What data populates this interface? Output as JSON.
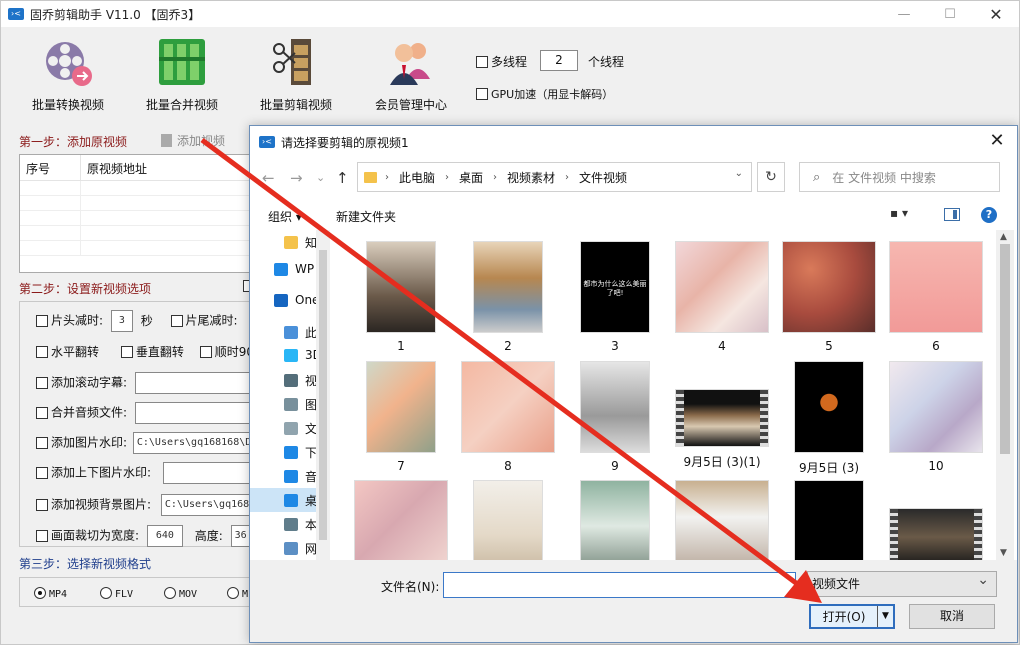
{
  "app": {
    "title": "固乔剪辑助手 V11.0  【固乔3】",
    "logo_text": "›<",
    "window_controls": {
      "minimize": "—",
      "maximize": "☐",
      "close": "✕"
    },
    "toolbar": [
      {
        "label": "批量转换视频",
        "icon": "film-reel-convert-icon"
      },
      {
        "label": "批量合并视频",
        "icon": "green-blocks-merge-icon"
      },
      {
        "label": "批量剪辑视频",
        "icon": "film-scissors-icon"
      },
      {
        "label": "会员管理中心",
        "icon": "members-icon"
      }
    ],
    "multithread": {
      "label": "多线程",
      "threads": "2",
      "threads_suffix": "个线程"
    },
    "gpu": {
      "label": "GPU加速（用显卡解码）"
    },
    "step1": {
      "title": "第一步：添加原视频",
      "add_button": "添加视频"
    },
    "file_list": {
      "col_index": "序号",
      "col_path": "原视频地址"
    },
    "step2": {
      "title": "第二步：设置新视频选项"
    },
    "options": {
      "head_cut": "片头减时:",
      "head_value": "3",
      "seconds": "秒",
      "tail_cut": "片尾减时:",
      "hflip": "水平翻转",
      "vflip": "垂直翻转",
      "rotate90": "顺时90",
      "scroll_subtitle": "添加滚动字幕:",
      "merge_audio": "合并音频文件:",
      "image_watermark": "添加图片水印:",
      "image_watermark_path": "C:\\Users\\gq168168\\D",
      "top_bottom_watermark": "添加上下图片水印:",
      "bg_image": "添加视频背景图片:",
      "bg_image_path": "C:\\Users\\gq168",
      "crop": "画面裁切为宽度:",
      "crop_width": "640",
      "crop_height_label": "高度:",
      "crop_height": "36"
    },
    "step3": {
      "title": "第三步：选择新视频格式"
    },
    "formats": [
      "MP4",
      "FLV",
      "MOV",
      "M"
    ]
  },
  "dialog": {
    "title": "请选择要剪辑的原视频1",
    "close": "✕",
    "nav": {
      "back": "←",
      "forward": "→",
      "recent": "⌄",
      "up": "↑"
    },
    "breadcrumb": [
      "此电脑",
      "桌面",
      "视频素材",
      "文件视频"
    ],
    "refresh": "↻",
    "search_placeholder": "在 文件视频 中搜索",
    "organize": "组织 ▾",
    "new_folder": "新建文件夹",
    "view_label": "▪ ▾",
    "help": "?",
    "tree": [
      {
        "label": "知",
        "icon": "folder-icon",
        "color": "#f4c24b"
      },
      {
        "label": "WP",
        "icon": "cloud-icon",
        "color": "#1e88e5"
      },
      {
        "label": "One",
        "icon": "onedrive-icon",
        "color": "#1565c0"
      },
      {
        "label": "此电",
        "icon": "computer-icon",
        "color": "#4a90d9"
      },
      {
        "label": "3D",
        "icon": "3d-objects-icon",
        "color": "#29b6f6"
      },
      {
        "label": "视",
        "icon": "videos-icon",
        "color": "#546e7a"
      },
      {
        "label": "图",
        "icon": "pictures-icon",
        "color": "#78909c"
      },
      {
        "label": "文",
        "icon": "documents-icon",
        "color": "#90a4ae"
      },
      {
        "label": "下",
        "icon": "downloads-icon",
        "color": "#1e88e5"
      },
      {
        "label": "音",
        "icon": "music-icon",
        "color": "#1e88e5"
      },
      {
        "label": "桌",
        "icon": "desktop-icon",
        "color": "#1e88e5",
        "selected": true
      },
      {
        "label": "本",
        "icon": "local-disk-icon",
        "color": "#607d8b"
      },
      {
        "label": "网",
        "icon": "network-icon",
        "color": "#5c8fc4"
      }
    ],
    "files": [
      {
        "name": "1",
        "bg": "linear-gradient(#d9cdbd,#6b5a4a 60%,#2b2622)",
        "portrait": true
      },
      {
        "name": "2",
        "bg": "linear-gradient(#e8d4b8,#b78750 40%,#7a92a8 75%,#ccc)",
        "portrait": true
      },
      {
        "name": "3",
        "bg": "#000",
        "portrait": true,
        "caption": "都市为什么这么美丽了吧!"
      },
      {
        "name": "4",
        "bg": "linear-gradient(135deg,#f2d7d9,#e8b4a8 40%,#f5e6e0 70%,#d8c0c8)",
        "portrait": false
      },
      {
        "name": "5",
        "bg": "radial-gradient(circle at 30% 30%,#d97a5a,#a84b3e 50%,#5a2e2a)",
        "portrait": false
      },
      {
        "name": "6",
        "bg": "linear-gradient(#f6b7b0,#f29a98)",
        "portrait": false
      },
      {
        "name": "7",
        "bg": "linear-gradient(135deg,#cfd8c8,#f1b38c 45%,#8fa089)",
        "portrait": true
      },
      {
        "name": "8",
        "bg": "linear-gradient(135deg,#f4b8a2,#f5d0c2 50%,#e9a08a)",
        "portrait": false
      },
      {
        "name": "9",
        "bg": "linear-gradient(#e6e6e6,#9a9a9a 60%,#dcdcdc)",
        "portrait": true
      },
      {
        "name": "9月5日 (3)(1)",
        "bg": "linear-gradient(#111,#111 25%,#8a6a4a 45%,#d8c8b0 65%,#111)",
        "portrait": false,
        "film": true
      },
      {
        "name": "9月5日 (3)",
        "bg": "radial-gradient(circle at 50% 45%,#d2691e 0 14%,#000 15%)",
        "portrait": true
      },
      {
        "name": "10",
        "bg": "linear-gradient(135deg,#f1e9ee,#cdd3e8 40%,#b8a8c8 70%,#e8e4ec)",
        "portrait": false
      },
      {
        "name": "",
        "bg": "linear-gradient(135deg,#f3c7c3,#d8a8b0 45%,#f2d8d2)",
        "portrait": false
      },
      {
        "name": "",
        "bg": "linear-gradient(#f2efe9,#e4d9c8 60%,#c8b8a0)",
        "portrait": true
      },
      {
        "name": "",
        "bg": "linear-gradient(#8fb3a0,#dfe9e2 50%,#7a8c80)",
        "portrait": true
      },
      {
        "name": "",
        "bg": "linear-gradient(#c8b090,#f2f2f0 40%,#b8a89a)",
        "portrait": false
      },
      {
        "name": "",
        "bg": "#000",
        "portrait": true
      },
      {
        "name": "",
        "bg": "linear-gradient(#2a2a2a,#6a5a48 50%,#1a1a1a)",
        "portrait": false,
        "film": true
      }
    ],
    "filename_label": "文件名(N):",
    "filename_value": "",
    "filetype": "视频文件",
    "open_button": "打开(O)",
    "cancel_button": "取消"
  },
  "annotation": {
    "color": "#e52d1f"
  }
}
